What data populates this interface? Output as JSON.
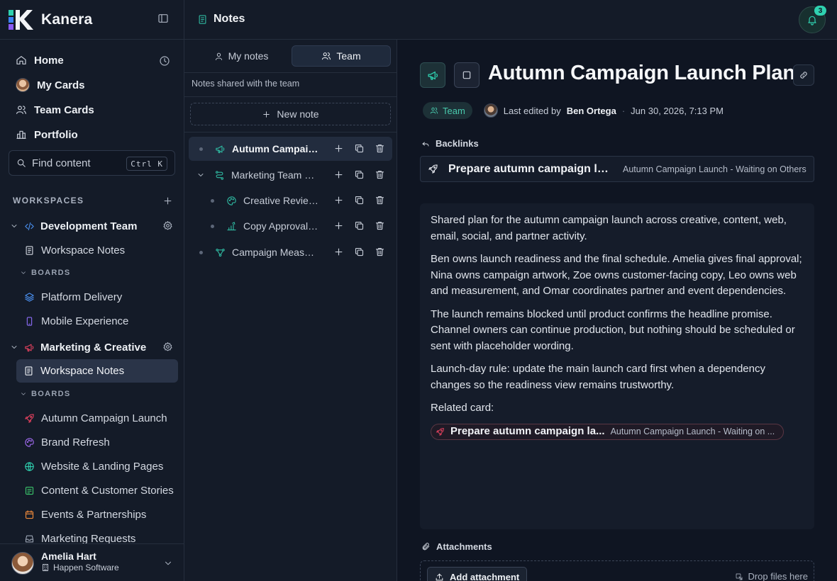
{
  "app": {
    "brand": "Kanera"
  },
  "colors": {
    "accent_teal": "#2fb8a0",
    "marketing_red": "#e0405d",
    "brand_blue": "#3b82f6"
  },
  "sidebar": {
    "nav": [
      {
        "label": "Home",
        "icon": "home-icon"
      },
      {
        "label": "My Cards",
        "icon": "avatar"
      },
      {
        "label": "Team Cards",
        "icon": "users-icon"
      },
      {
        "label": "Portfolio",
        "icon": "bar-chart-icon"
      }
    ],
    "search": {
      "placeholder": "Find content",
      "shortcut": "Ctrl K"
    },
    "workspaces_label": "WORKSPACES",
    "workspaces": [
      {
        "name": "Development Team",
        "notes_label": "Workspace Notes",
        "boards_label": "BOARDS",
        "boards": [
          "Platform Delivery",
          "Mobile Experience"
        ]
      },
      {
        "name": "Marketing & Creative",
        "notes_label": "Workspace Notes",
        "boards_label": "BOARDS",
        "boards": [
          "Autumn Campaign Launch",
          "Brand Refresh",
          "Website & Landing Pages",
          "Content & Customer Stories",
          "Events & Partnerships",
          "Marketing Requests"
        ]
      }
    ],
    "user": {
      "name": "Amelia Hart",
      "org": "Happen Software"
    }
  },
  "header": {
    "title": "Notes",
    "notification_count": "3"
  },
  "notes_panel": {
    "tabs": [
      "My notes",
      "Team"
    ],
    "active_tab": "Team",
    "hint": "Notes shared with the team",
    "new_note_label": "New note",
    "items": [
      {
        "label": "Autumn Campaign Launch Plan",
        "level": 0,
        "icon": "megaphone-icon",
        "expanded": null,
        "active": true
      },
      {
        "label": "Marketing Team Workflow",
        "level": 0,
        "icon": "workflow-icon",
        "expanded": true,
        "active": false
      },
      {
        "label": "Creative Review Guidelines",
        "level": 1,
        "icon": "palette-icon",
        "expanded": null,
        "active": false
      },
      {
        "label": "Copy Approval Process",
        "level": 1,
        "icon": "chart-icon",
        "expanded": null,
        "active": false
      },
      {
        "label": "Campaign Measurement Plan",
        "level": 0,
        "icon": "flow-icon",
        "expanded": null,
        "active": false
      }
    ]
  },
  "note": {
    "title": "Autumn Campaign Launch Plan",
    "visibility": "Team",
    "last_edited_prefix": "Last edited by",
    "last_edited_by": "Ben Ortega",
    "last_edited_at": "Jun 30, 2026, 7:13 PM",
    "backlinks_label": "Backlinks",
    "backlink": {
      "title": "Prepare autumn campaign launch",
      "board": "Autumn Campaign Launch - Waiting on Others"
    },
    "paragraphs": [
      "Shared plan for the autumn campaign launch across creative, content, web, email, social, and partner activity.",
      "Ben owns launch readiness and the final schedule. Amelia gives final approval; Nina owns campaign artwork, Zoe owns customer-facing copy, Leo owns web and measurement, and Omar coordinates partner and event dependencies.",
      "The launch remains blocked until product confirms the headline promise. Channel owners can continue production, but nothing should be scheduled or sent with placeholder wording.",
      "Launch-day rule: update the main launch card first when a dependency changes so the readiness view remains trustworthy."
    ],
    "related_label": "Related card:",
    "related_card": {
      "title": "Prepare autumn campaign la...",
      "board": "Autumn Campaign Launch - Waiting on ..."
    },
    "attachments_label": "Attachments",
    "add_attachment_label": "Add attachment",
    "drop_hint": "Drop files here"
  }
}
